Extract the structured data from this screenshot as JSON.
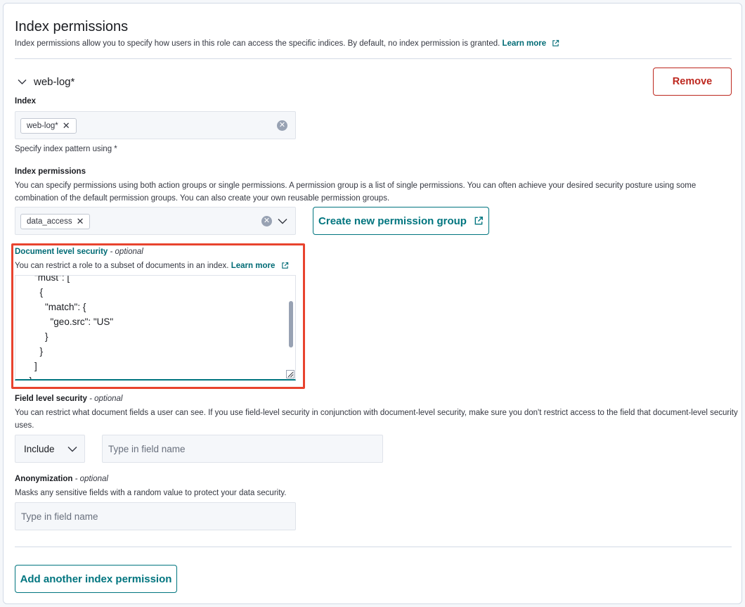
{
  "header": {
    "title": "Index permissions",
    "description": "Index permissions allow you to specify how users in this role can access the specific indices. By default, no index permission is granted.",
    "learn_more": "Learn more"
  },
  "permission": {
    "accordion_title": "web-log*",
    "remove_label": "Remove",
    "index": {
      "label": "Index",
      "chip": "web-log*",
      "help": "Specify index pattern using *"
    },
    "index_permissions": {
      "label": "Index permissions",
      "description": "You can specify permissions using both action groups or single permissions. A permission group is a list of single permissions. You can often achieve your desired security posture using some combination of the default permission groups. You can also create your own reusable permission groups.",
      "chip": "data_access",
      "create_group_label": "Create new permission group"
    },
    "dls": {
      "label": "Document level security",
      "optional": "- optional",
      "description": "You can restrict a role to a subset of documents in an index.",
      "learn_more": "Learn more",
      "code": "    \"must\": [\n      {\n        \"match\": {\n          \"geo.src\": \"US\"\n        }\n      }\n    ]\n  }"
    },
    "fls": {
      "label": "Field level security",
      "optional": "- optional",
      "description": "You can restrict what document fields a user can see. If you use field-level security in conjunction with document-level security, make sure you don't restrict access to the field that document-level security uses.",
      "mode": "Include",
      "placeholder": "Type in field name"
    },
    "anonymization": {
      "label": "Anonymization",
      "optional": "- optional",
      "description": "Masks any sensitive fields with a random value to protect your data security.",
      "placeholder": "Type in field name"
    }
  },
  "footer": {
    "add_label": "Add another index permission"
  },
  "colors": {
    "accent": "#00757f",
    "danger": "#bd271e",
    "highlight": "#e8432e"
  }
}
